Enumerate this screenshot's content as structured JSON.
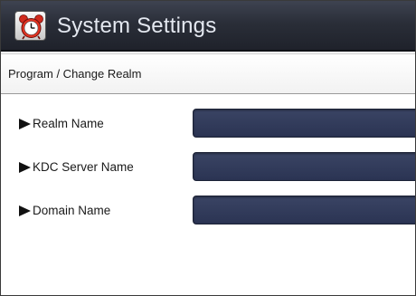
{
  "window": {
    "title": "System Settings"
  },
  "header": {
    "breadcrumb": "Program / Change Realm"
  },
  "form": {
    "fields": [
      {
        "label": "Realm Name",
        "value": ""
      },
      {
        "label": "KDC Server Name",
        "value": ""
      },
      {
        "label": "Domain Name",
        "value": ""
      }
    ]
  },
  "colors": {
    "titlebar": "#2a2e38",
    "input_fill": "#2f3858",
    "title_text": "#e4e8f0"
  },
  "icons": {
    "app": "alarm-clock-icon",
    "field_marker": "triangle-right-icon"
  }
}
